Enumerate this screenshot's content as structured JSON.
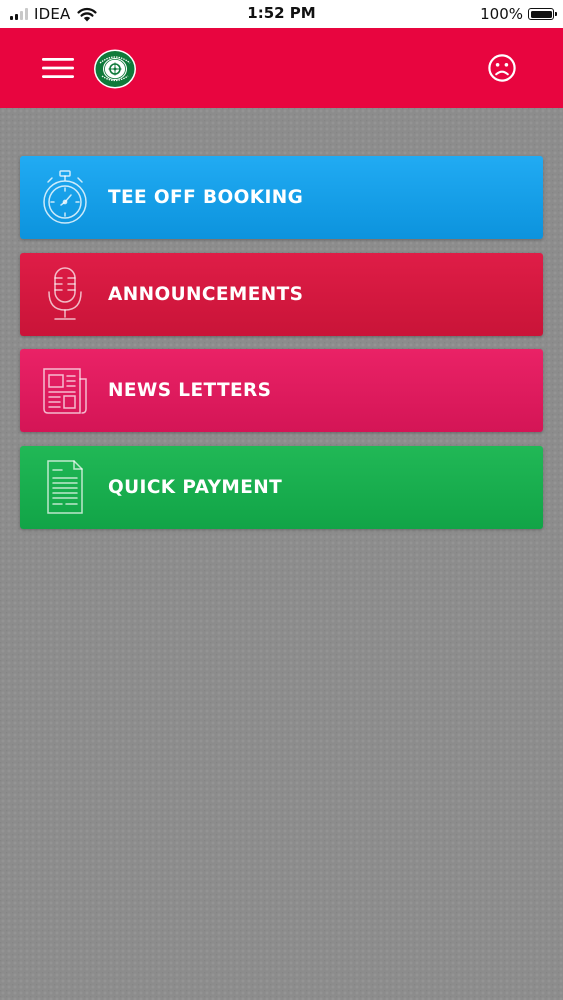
{
  "status_bar": {
    "carrier": "IDEA",
    "time": "1:52 PM",
    "battery": "100%"
  },
  "header": {
    "menu_icon": "hamburger-icon",
    "logo": "golf-club-logo",
    "profile_icon": "sad-face-icon"
  },
  "menu": {
    "items": [
      {
        "label": "TEE OFF BOOKING",
        "icon": "stopwatch-icon",
        "color": "#1ba3ec"
      },
      {
        "label": "ANNOUNCEMENTS",
        "icon": "microphone-icon",
        "color": "#d81a42"
      },
      {
        "label": "NEWS LETTERS",
        "icon": "newspaper-icon",
        "color": "#e21a5f"
      },
      {
        "label": "QUICK PAYMENT",
        "icon": "document-icon",
        "color": "#19ae4f"
      }
    ]
  },
  "colors": {
    "header": "#e8053f",
    "background": "#8c8c8c"
  }
}
